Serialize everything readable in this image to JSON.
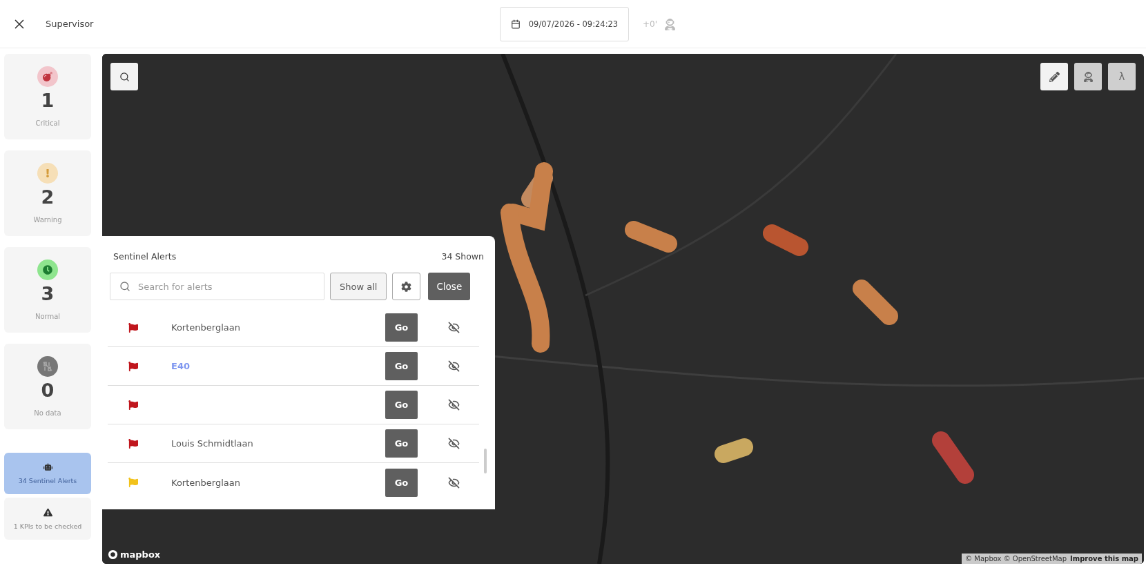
{
  "window": {
    "title": "Supervisor"
  },
  "header": {
    "datetime": "09/07/2026 - 09:24:23",
    "offset": "+0'"
  },
  "status_cards": [
    {
      "kind": "critical",
      "count": "1",
      "label": "Critical"
    },
    {
      "kind": "warning",
      "count": "2",
      "label": "Warning"
    },
    {
      "kind": "normal",
      "count": "3",
      "label": "Normal"
    },
    {
      "kind": "nodata",
      "count": "0",
      "label": "No data"
    }
  ],
  "side_buttons": [
    {
      "kind": "robot",
      "label": "34 Sentinel Alerts",
      "selected": true
    },
    {
      "kind": "triangle",
      "label": "1 KPIs to be checked",
      "selected": false
    }
  ],
  "map": {
    "kind": "picture",
    "tools": [
      {
        "kind": "pencil",
        "disabled": false
      },
      {
        "kind": "astronaut",
        "disabled": true
      },
      {
        "kind": "text",
        "label": "λ",
        "disabled": true
      }
    ],
    "logo": "mapbox",
    "attribution": "© Mapbox © OpenStreetMap",
    "improve_link": "Improve this map"
  },
  "alerts_panel": {
    "title": "Sentinel Alerts",
    "count": "34 Shown",
    "search": {
      "placeholder": "Search for alerts"
    },
    "show_all": "Show all",
    "close": "Close",
    "rows": [
      {
        "name": "Kortenberglaan",
        "kind": "plain",
        "color": "#c0161d",
        "action": "Go"
      },
      {
        "name": "E40",
        "kind": "link",
        "color": "#c0161d",
        "action": "Go"
      },
      {
        "kind": "plain",
        "color": "#c0161d",
        "action": "Go"
      },
      {
        "name": "Louis Schmidtlaan",
        "kind": "plain",
        "color": "#c0161d",
        "action": "Go"
      },
      {
        "name": "Kortenberglaan",
        "kind": "plain",
        "color": "#f2c21b",
        "action": "Go"
      }
    ]
  }
}
